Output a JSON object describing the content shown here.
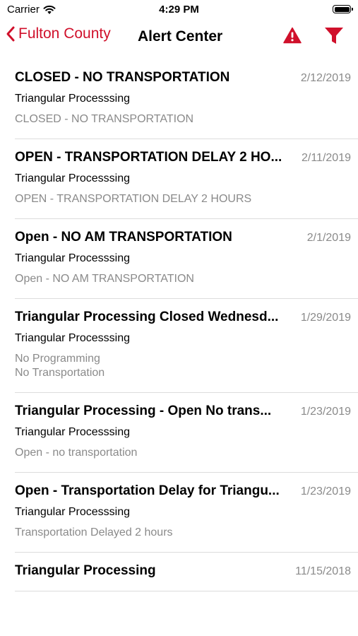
{
  "status_bar": {
    "carrier": "Carrier",
    "time": "4:29 PM"
  },
  "nav": {
    "back_label": "Fulton County",
    "title": "Alert Center",
    "accent_color": "#d0102b"
  },
  "alerts": [
    {
      "title": "CLOSED - NO TRANSPORTATION",
      "date": "2/12/2019",
      "source": "Triangular Processsing",
      "message_lines": [
        "CLOSED - NO TRANSPORTATION"
      ]
    },
    {
      "title": "OPEN - TRANSPORTATION DELAY 2 HO...",
      "date": "2/11/2019",
      "source": "Triangular Processsing",
      "message_lines": [
        "OPEN - TRANSPORTATION DELAY 2 HOURS"
      ]
    },
    {
      "title": "Open - NO AM TRANSPORTATION",
      "date": "2/1/2019",
      "source": "Triangular Processsing",
      "message_lines": [
        "Open - NO AM TRANSPORTATION"
      ]
    },
    {
      "title": "Triangular Processing Closed Wednesd...",
      "date": "1/29/2019",
      "source": "Triangular Processsing",
      "message_lines": [
        "No Programming",
        "No Transportation"
      ]
    },
    {
      "title": "Triangular Processing  -  Open No trans...",
      "date": "1/23/2019",
      "source": "Triangular Processsing",
      "message_lines": [
        "Open - no transportation"
      ]
    },
    {
      "title": "Open - Transportation Delay for Triangu...",
      "date": "1/23/2019",
      "source": "Triangular Processsing",
      "message_lines": [
        "Transportation Delayed 2 hours"
      ]
    },
    {
      "title": "Triangular Processing",
      "date": "11/15/2018",
      "source": "",
      "message_lines": []
    }
  ]
}
